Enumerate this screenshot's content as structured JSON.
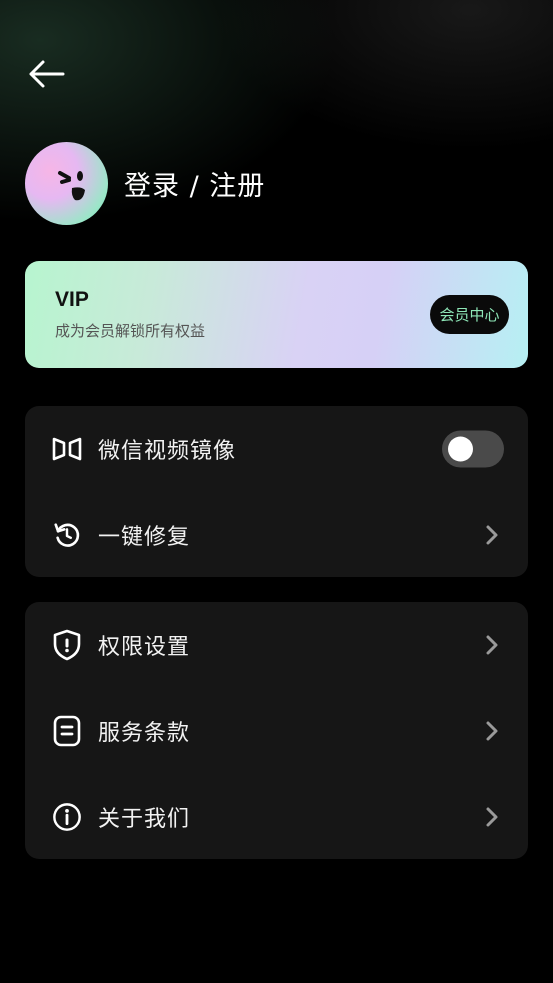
{
  "header": {
    "back_icon": "arrow-left-icon"
  },
  "profile": {
    "avatar_icon": "emoji-face-avatar",
    "login_label": "登录 / 注册"
  },
  "vip_card": {
    "title": "VIP",
    "subtitle": "成为会员解锁所有权益",
    "button_label": "会员中心",
    "accent_color": "#8ee6b7"
  },
  "settings_group_1": {
    "items": [
      {
        "label": "微信视频镜像",
        "icon": "mirror-icon",
        "control": "toggle",
        "enabled": false
      },
      {
        "label": "一键修复",
        "icon": "refresh-icon",
        "control": "chevron"
      }
    ]
  },
  "settings_group_2": {
    "items": [
      {
        "label": "权限设置",
        "icon": "shield-icon",
        "control": "chevron"
      },
      {
        "label": "服务条款",
        "icon": "document-icon",
        "control": "chevron"
      },
      {
        "label": "关于我们",
        "icon": "info-icon",
        "control": "chevron"
      }
    ]
  }
}
